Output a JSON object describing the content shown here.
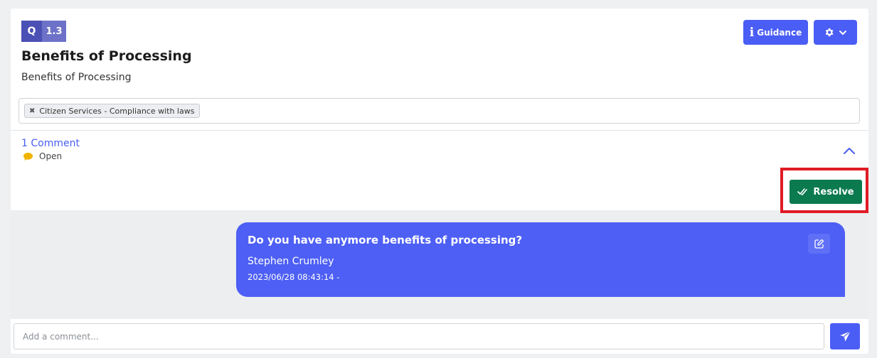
{
  "question": {
    "prefix": "Q",
    "number": "1.3",
    "title": "Benefits of Processing",
    "description": "Benefits of Processing"
  },
  "header_buttons": {
    "guidance_icon": "info-icon",
    "guidance_label": "Guidance",
    "settings_icon": "gear-icon",
    "settings_dropdown_icon": "chevron-down-icon"
  },
  "tags": [
    {
      "label": "Citizen Services - Compliance with laws",
      "remove_symbol": "✖"
    }
  ],
  "comments": {
    "count_label": "1 Comment",
    "status": "Open",
    "status_icon": "comment-bubble-icon",
    "resolve_label": "Resolve",
    "thread": [
      {
        "message": "Do you have anymore benefits of processing?",
        "author": "Stephen Crumley",
        "timestamp": "2023/06/28 08:43:14 -"
      }
    ],
    "input_placeholder": "Add a comment..."
  },
  "colors": {
    "primary": "#4a5df5",
    "bubble": "#4d5ff4",
    "resolve": "#0b7a4f",
    "highlight": "#e01b24",
    "status_icon": "#f0b400"
  }
}
